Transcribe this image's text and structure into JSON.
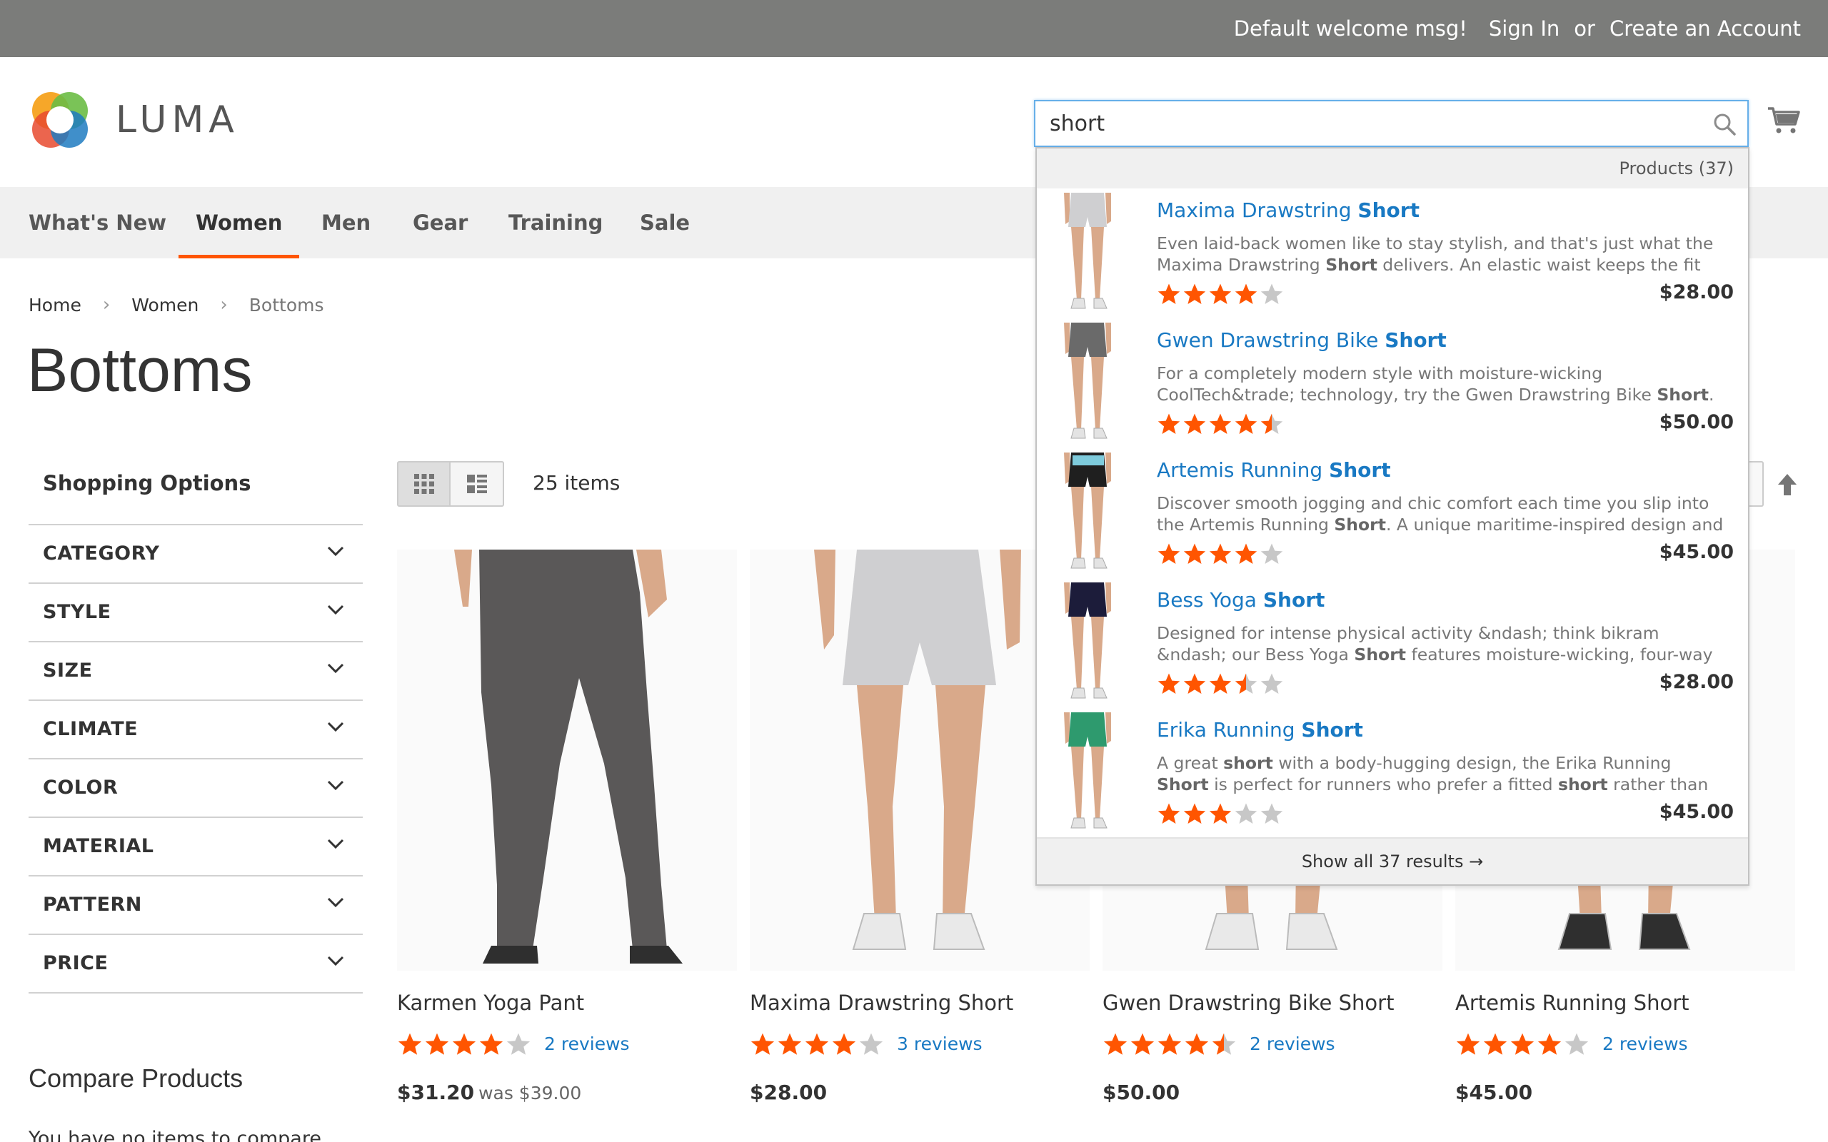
{
  "colors": {
    "accent": "#ff5501",
    "link": "#1979c3",
    "topbar": "#7b7c7a",
    "star_empty": "#c7c7c7"
  },
  "topbar": {
    "welcome": "Default welcome msg!",
    "sign_in": "Sign In",
    "or": "or",
    "create_account": "Create an Account"
  },
  "header": {
    "logo_text": "LUMA"
  },
  "search": {
    "value": "short",
    "icon": "search-icon"
  },
  "cart": {
    "icon": "cart-icon"
  },
  "nav": [
    "What's New",
    "Women",
    "Men",
    "Gear",
    "Training",
    "Sale"
  ],
  "nav_active": "Women",
  "breadcrumb": {
    "home": "Home",
    "women": "Women",
    "current": "Bottoms"
  },
  "page_title": "Bottoms",
  "sidebar": {
    "title": "Shopping Options",
    "filters": [
      "CATEGORY",
      "STYLE",
      "SIZE",
      "CLIMATE",
      "COLOR",
      "MATERIAL",
      "PATTERN",
      "PRICE"
    ],
    "compare_title": "Compare Products",
    "compare_empty": "You have no items to compare."
  },
  "toolbar": {
    "amount": "25 items"
  },
  "products": [
    {
      "name": "Karmen Yoga Pant",
      "rating": 4,
      "reviews": "2 reviews",
      "price": "$31.20",
      "old_price": "was $39.00"
    },
    {
      "name": "Maxima Drawstring Short",
      "rating": 4,
      "reviews": "3 reviews",
      "price": "$28.00",
      "old_price": ""
    },
    {
      "name": "Gwen Drawstring Bike Short",
      "rating": 4.5,
      "reviews": "2 reviews",
      "price": "$50.00",
      "old_price": ""
    },
    {
      "name": "Artemis Running Short",
      "rating": 4,
      "reviews": "2 reviews",
      "price": "$45.00",
      "old_price": ""
    }
  ],
  "autocomplete": {
    "header": "Products (37)",
    "items": [
      {
        "name_pre": "Maxima Drawstring ",
        "name_hl": "Short",
        "desc_1": "Even laid-back women like to stay stylish, and that's just what the Maxima Drawstring ",
        "desc_hl_1": "Short",
        "desc_2": " delivers. An elastic waist keeps the fit flexible,",
        "rating": 4,
        "price": "$28.00"
      },
      {
        "name_pre": "Gwen Drawstring Bike ",
        "name_hl": "Short",
        "desc_1": "For a completely modern style with moisture-wicking CoolTech&trade; technology, try the Gwen Drawstring Bike ",
        "desc_hl_1": "Short",
        "desc_2": ". Subtle grays and eye",
        "rating": 4.5,
        "price": "$50.00"
      },
      {
        "name_pre": "Artemis Running ",
        "name_hl": "Short",
        "desc_1": "Discover smooth jogging and chic comfort each time you slip into the Artemis Running ",
        "desc_hl_1": "Short",
        "desc_2": ". A unique maritime-inspired design and color",
        "rating": 4,
        "price": "$45.00"
      },
      {
        "name_pre": "Bess Yoga ",
        "name_hl": "Short",
        "desc_1": "Designed for intense physical activity &ndash; think bikram &ndash; our Bess Yoga ",
        "desc_hl_1": "Short",
        "desc_2": " features moisture-wicking, four-way stretch fabric that",
        "rating": 3.5,
        "price": "$28.00"
      },
      {
        "name_pre": "Erika Running ",
        "name_hl": "Short",
        "desc_1": "A great ",
        "desc_hl_1": "short",
        "desc_2": " with a body-hugging design, the Erika Running ",
        "desc_hl_2": "Short",
        "desc_3": " is perfect for runners who prefer a fitted ",
        "desc_hl_3": "short",
        "desc_4": " rather than the traditional",
        "rating": 3,
        "price": "$45.00"
      }
    ],
    "footer": "Show all 37 results →"
  }
}
